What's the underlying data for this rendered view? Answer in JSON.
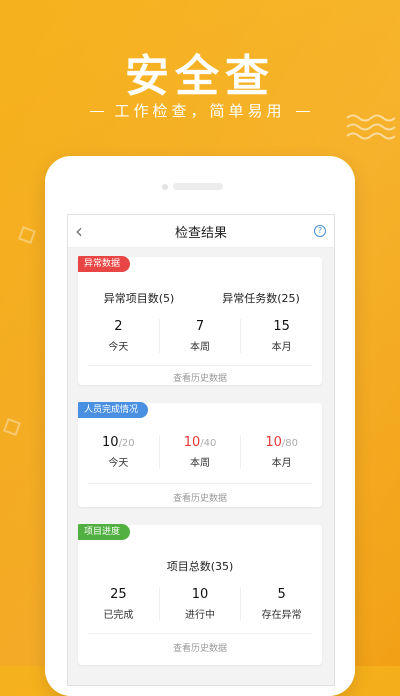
{
  "hero": {
    "title": "安全查",
    "subtitle": "工作检查，简单易用"
  },
  "nav": {
    "title": "检查结果",
    "back_icon": "chevron-left-icon",
    "help_icon": "question-icon"
  },
  "colors": {
    "background": "#f4a818",
    "red_tag": "#e84545",
    "blue_tag": "#4a90e2",
    "green_tag": "#52b043",
    "red_text": "#e53935"
  },
  "cards": [
    {
      "tag": "异常数据",
      "summary": [
        "异常项目数(5)",
        "异常任务数(25)"
      ],
      "stats": [
        {
          "value": "2",
          "label": "今天"
        },
        {
          "value": "7",
          "label": "本周"
        },
        {
          "value": "15",
          "label": "本月"
        }
      ],
      "history": "查看历史数据"
    },
    {
      "tag": "人员完成情况",
      "stats": [
        {
          "value": "10",
          "total": "/20",
          "label": "今天"
        },
        {
          "value": "10",
          "total": "/40",
          "label": "本周"
        },
        {
          "value": "10",
          "total": "/80",
          "label": "本月"
        }
      ],
      "history": "查看历史数据"
    },
    {
      "tag": "项目进度",
      "summary": [
        "项目总数(35)"
      ],
      "stats": [
        {
          "value": "25",
          "label": "已完成"
        },
        {
          "value": "10",
          "label": "进行中"
        },
        {
          "value": "5",
          "label": "存在异常"
        }
      ],
      "history": "查看历史数据"
    }
  ]
}
